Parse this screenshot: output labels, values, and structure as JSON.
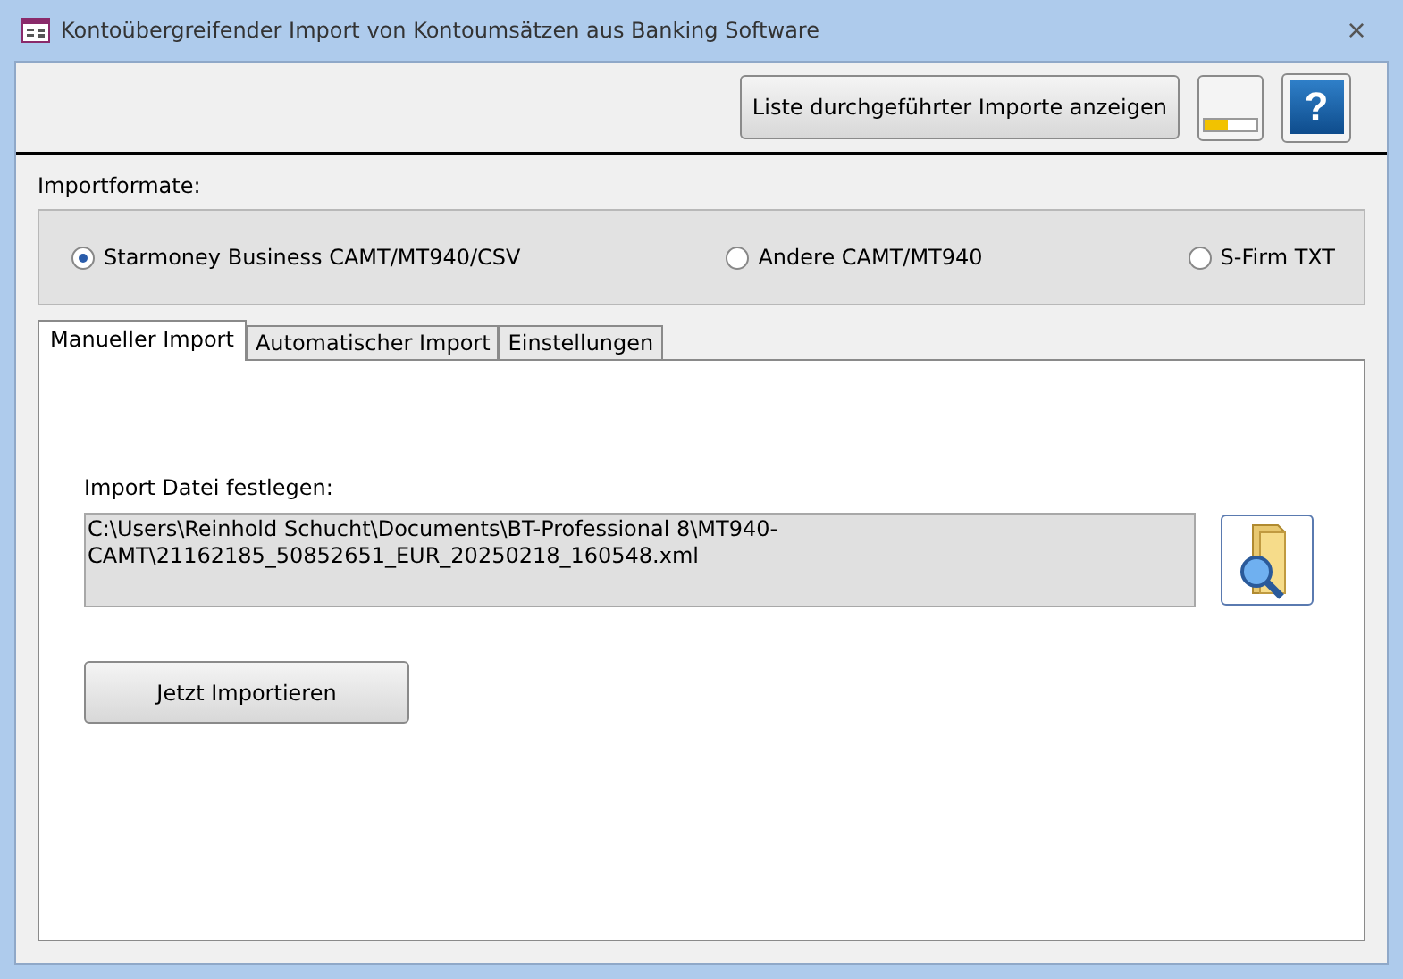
{
  "window": {
    "title": "Kontoübergreifender Import von Kontoumsätzen aus Banking Software",
    "close": "×"
  },
  "toolbar": {
    "history_button": "Liste durchgeführter Importe anzeigen",
    "progress": {
      "level": 0.45
    },
    "help_button": "?"
  },
  "formats": {
    "label": "Importformate:",
    "options": [
      {
        "label": "Starmoney Business CAMT/MT940/CSV",
        "selected": true
      },
      {
        "label": "Andere CAMT/MT940",
        "selected": false
      },
      {
        "label": "S-Firm TXT",
        "selected": false
      }
    ]
  },
  "tabs": [
    {
      "label": "Manueller Import",
      "selected": true
    },
    {
      "label": "Automatischer Import",
      "selected": false
    },
    {
      "label": "Einstellungen",
      "selected": false
    }
  ],
  "manual": {
    "file_label": "Import Datei festlegen:",
    "file_path": "C:\\Users\\Reinhold Schucht\\Documents\\BT-Professional 8\\MT940-CAMT\\21162185_50852651_EUR_20250218_160548.xml",
    "import_button": "Jetzt Importieren"
  }
}
